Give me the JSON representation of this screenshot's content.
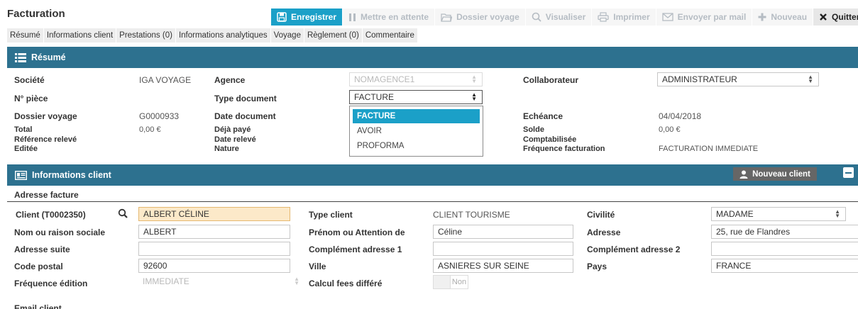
{
  "app": {
    "title": "Facturation"
  },
  "toolbar": {
    "save": "Enregistrer",
    "hold": "Mettre en attente",
    "folder": "Dossier voyage",
    "view": "Visualiser",
    "print": "Imprimer",
    "mail": "Envoyer par mail",
    "new": "Nouveau",
    "quit": "Quitter"
  },
  "tabs": [
    "Résumé",
    "Informations client",
    "Prestations (0)",
    "Informations analytiques",
    "Voyage",
    "Règlement (0)",
    "Commentaire"
  ],
  "resume": {
    "title": "Résumé",
    "societe_label": "Société",
    "societe_value": "IGA VOYAGE",
    "agence_label": "Agence",
    "agence_value": "NOMAGENCE1",
    "collaborateur_label": "Collaborateur",
    "collaborateur_value": "ADMINISTRATEUR",
    "piece_label": "N° pièce",
    "type_doc_label": "Type document",
    "type_doc_value": "FACTURE",
    "dossier_label": "Dossier voyage",
    "dossier_value": "G0000933",
    "date_doc_label": "Date document",
    "echeance_label": "Echéance",
    "echeance_value": "04/04/2018",
    "total_label": "Total",
    "total_value": "0,00 €",
    "deja_paye_label": "Déjà payé",
    "solde_label": "Solde",
    "solde_value": "0,00 €",
    "ref_releve_label": "Référence relevé",
    "date_releve_label": "Date relevé",
    "comptabilisee_label": "Comptabilisée",
    "editee_label": "Editée",
    "nature_label": "Nature",
    "freq_fact_label": "Fréquence facturation",
    "freq_fact_value": "FACTURATION IMMEDIATE",
    "type_doc_options": [
      "FACTURE",
      "AVOIR",
      "PROFORMA"
    ]
  },
  "client": {
    "title": "Informations client",
    "new_client_button": "Nouveau client",
    "subsection": "Adresse facture",
    "client_label": "Client (T0002350)",
    "client_value": "ALBERT CÉLINE",
    "type_client_label": "Type client",
    "type_client_value": "CLIENT TOURISME",
    "civilite_label": "Civilité",
    "civilite_value": "MADAME",
    "nom_label": "Nom ou raison sociale",
    "nom_value": "ALBERT",
    "prenom_label": "Prénom ou Attention de",
    "prenom_value": "Céline",
    "adresse_label": "Adresse",
    "adresse_value": "25, rue de Flandres",
    "adresse_suite_label": "Adresse suite",
    "adresse_suite_value": "",
    "complement1_label": "Complément adresse 1",
    "complement1_value": "",
    "complement2_label": "Complément adresse 2",
    "complement2_value": "",
    "cp_label": "Code postal",
    "cp_value": "92600",
    "ville_label": "Ville",
    "ville_value": "ASNIERES SUR SEINE",
    "pays_label": "Pays",
    "pays_value": "FRANCE",
    "freq_edition_label": "Fréquence édition",
    "freq_edition_value": "IMMEDIATE",
    "calcul_fees_label": "Calcul fees différé",
    "calcul_fees_value": "Non",
    "email_label": "Email client"
  },
  "colors": {
    "accent": "#1ba0c8",
    "section_bar": "#2d718f",
    "highlight_field": "#fce9c9"
  }
}
